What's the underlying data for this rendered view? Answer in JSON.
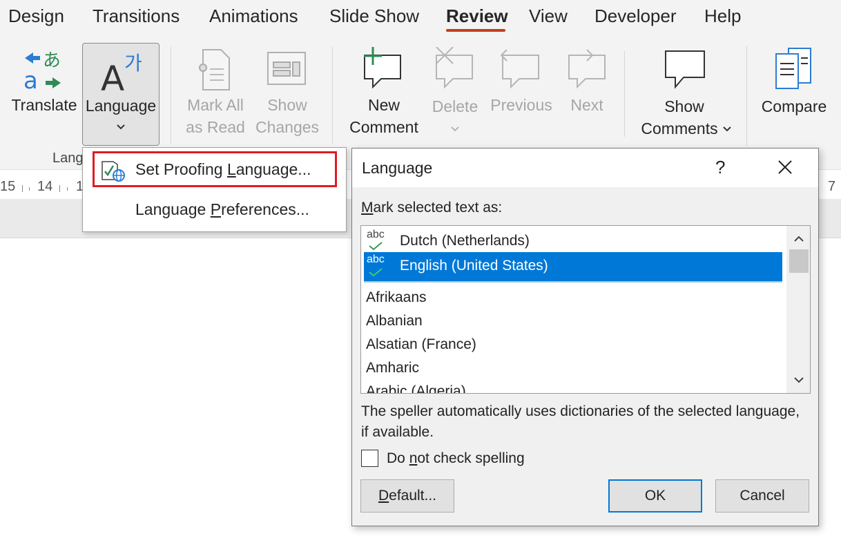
{
  "tabs": [
    {
      "label": "Design"
    },
    {
      "label": "Transitions"
    },
    {
      "label": "Animations"
    },
    {
      "label": "Slide Show"
    },
    {
      "label": "Review"
    },
    {
      "label": "View"
    },
    {
      "label": "Developer"
    },
    {
      "label": "Help"
    }
  ],
  "active_tab": "Review",
  "ribbon": {
    "translate": "Translate",
    "language": "Language",
    "mark_all_line1": "Mark All",
    "mark_all_line2": "as Read",
    "show_changes_line1": "Show",
    "show_changes_line2": "Changes",
    "new_comment_line1": "New",
    "new_comment_line2": "Comment",
    "delete": "Delete",
    "previous": "Previous",
    "next": "Next",
    "show_comments_line1": "Show",
    "show_comments_line2": "Comments",
    "compare": "Compare",
    "group_label": "Lang",
    "accent_green": "#2e8b57",
    "accent_blue": "#2b7cd3"
  },
  "ruler": {
    "left_labels": [
      "15",
      "14",
      "1"
    ],
    "right_label": "7"
  },
  "menu": {
    "items": [
      {
        "pre": "Set Proofing ",
        "accel": "L",
        "post": "anguage..."
      },
      {
        "pre": "Language ",
        "accel": "P",
        "post": "references..."
      }
    ]
  },
  "dialog": {
    "title": "Language",
    "help": "?",
    "mark_label_accel": "M",
    "mark_label_rest": "ark selected text as:",
    "languages": [
      {
        "name": "Dutch (Netherlands)",
        "proof": "abc",
        "selected": false
      },
      {
        "name": "English (United States)",
        "proof": "abc",
        "selected": true
      },
      {
        "name": "Afrikaans",
        "selected": false
      },
      {
        "name": "Albanian",
        "selected": false
      },
      {
        "name": "Alsatian (France)",
        "selected": false
      },
      {
        "name": "Amharic",
        "selected": false
      },
      {
        "name": "Arabic (Algeria)",
        "selected": false
      }
    ],
    "description": "The speller automatically uses dictionaries of the selected language, if available.",
    "checkbox_pre": "Do ",
    "checkbox_accel": "n",
    "checkbox_post": "ot check spelling",
    "checkbox_checked": false,
    "default_accel": "D",
    "default_rest": "efault...",
    "ok": "OK",
    "cancel": "Cancel",
    "selection_color": "#0078d7"
  }
}
